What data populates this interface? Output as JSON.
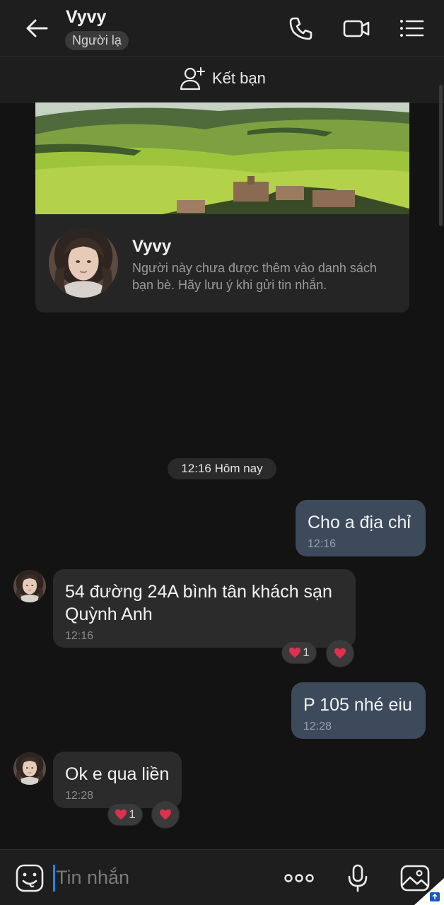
{
  "header": {
    "title": "Vyvy",
    "badge": "Người lạ",
    "add_friend_label": "Kết bạn"
  },
  "profile_card": {
    "name": "Vyvy",
    "note": "Người này chưa được thêm vào danh sách bạn bè. Hãy lưu ý khi gửi tin nhắn."
  },
  "chat": {
    "date_divider": "12:16 Hôm nay",
    "messages": [
      {
        "from": "me",
        "text": "Cho a địa chỉ",
        "time": "12:16"
      },
      {
        "from": "them",
        "text": "54 đường 24A bình tân khách sạn Quỳnh Anh",
        "time": "12:16",
        "reaction_count": "1"
      },
      {
        "from": "me",
        "text": "P 105 nhé eiu",
        "time": "12:28"
      },
      {
        "from": "them",
        "text": "Ok e qua liền",
        "time": "12:28",
        "reaction_count": "1"
      }
    ]
  },
  "composer": {
    "placeholder": "Tin nhắn"
  },
  "colors": {
    "background": "#131313",
    "my_bubble": "#3c4a5c",
    "their_bubble": "#2b2b2b",
    "heart": "#e0304e",
    "caret": "#1e88e5"
  },
  "icons": [
    "back-arrow-icon",
    "phone-icon",
    "video-call-icon",
    "list-menu-icon",
    "add-friend-icon",
    "heart-icon",
    "emoji-icon",
    "more-dots-icon",
    "microphone-icon",
    "image-icon"
  ]
}
